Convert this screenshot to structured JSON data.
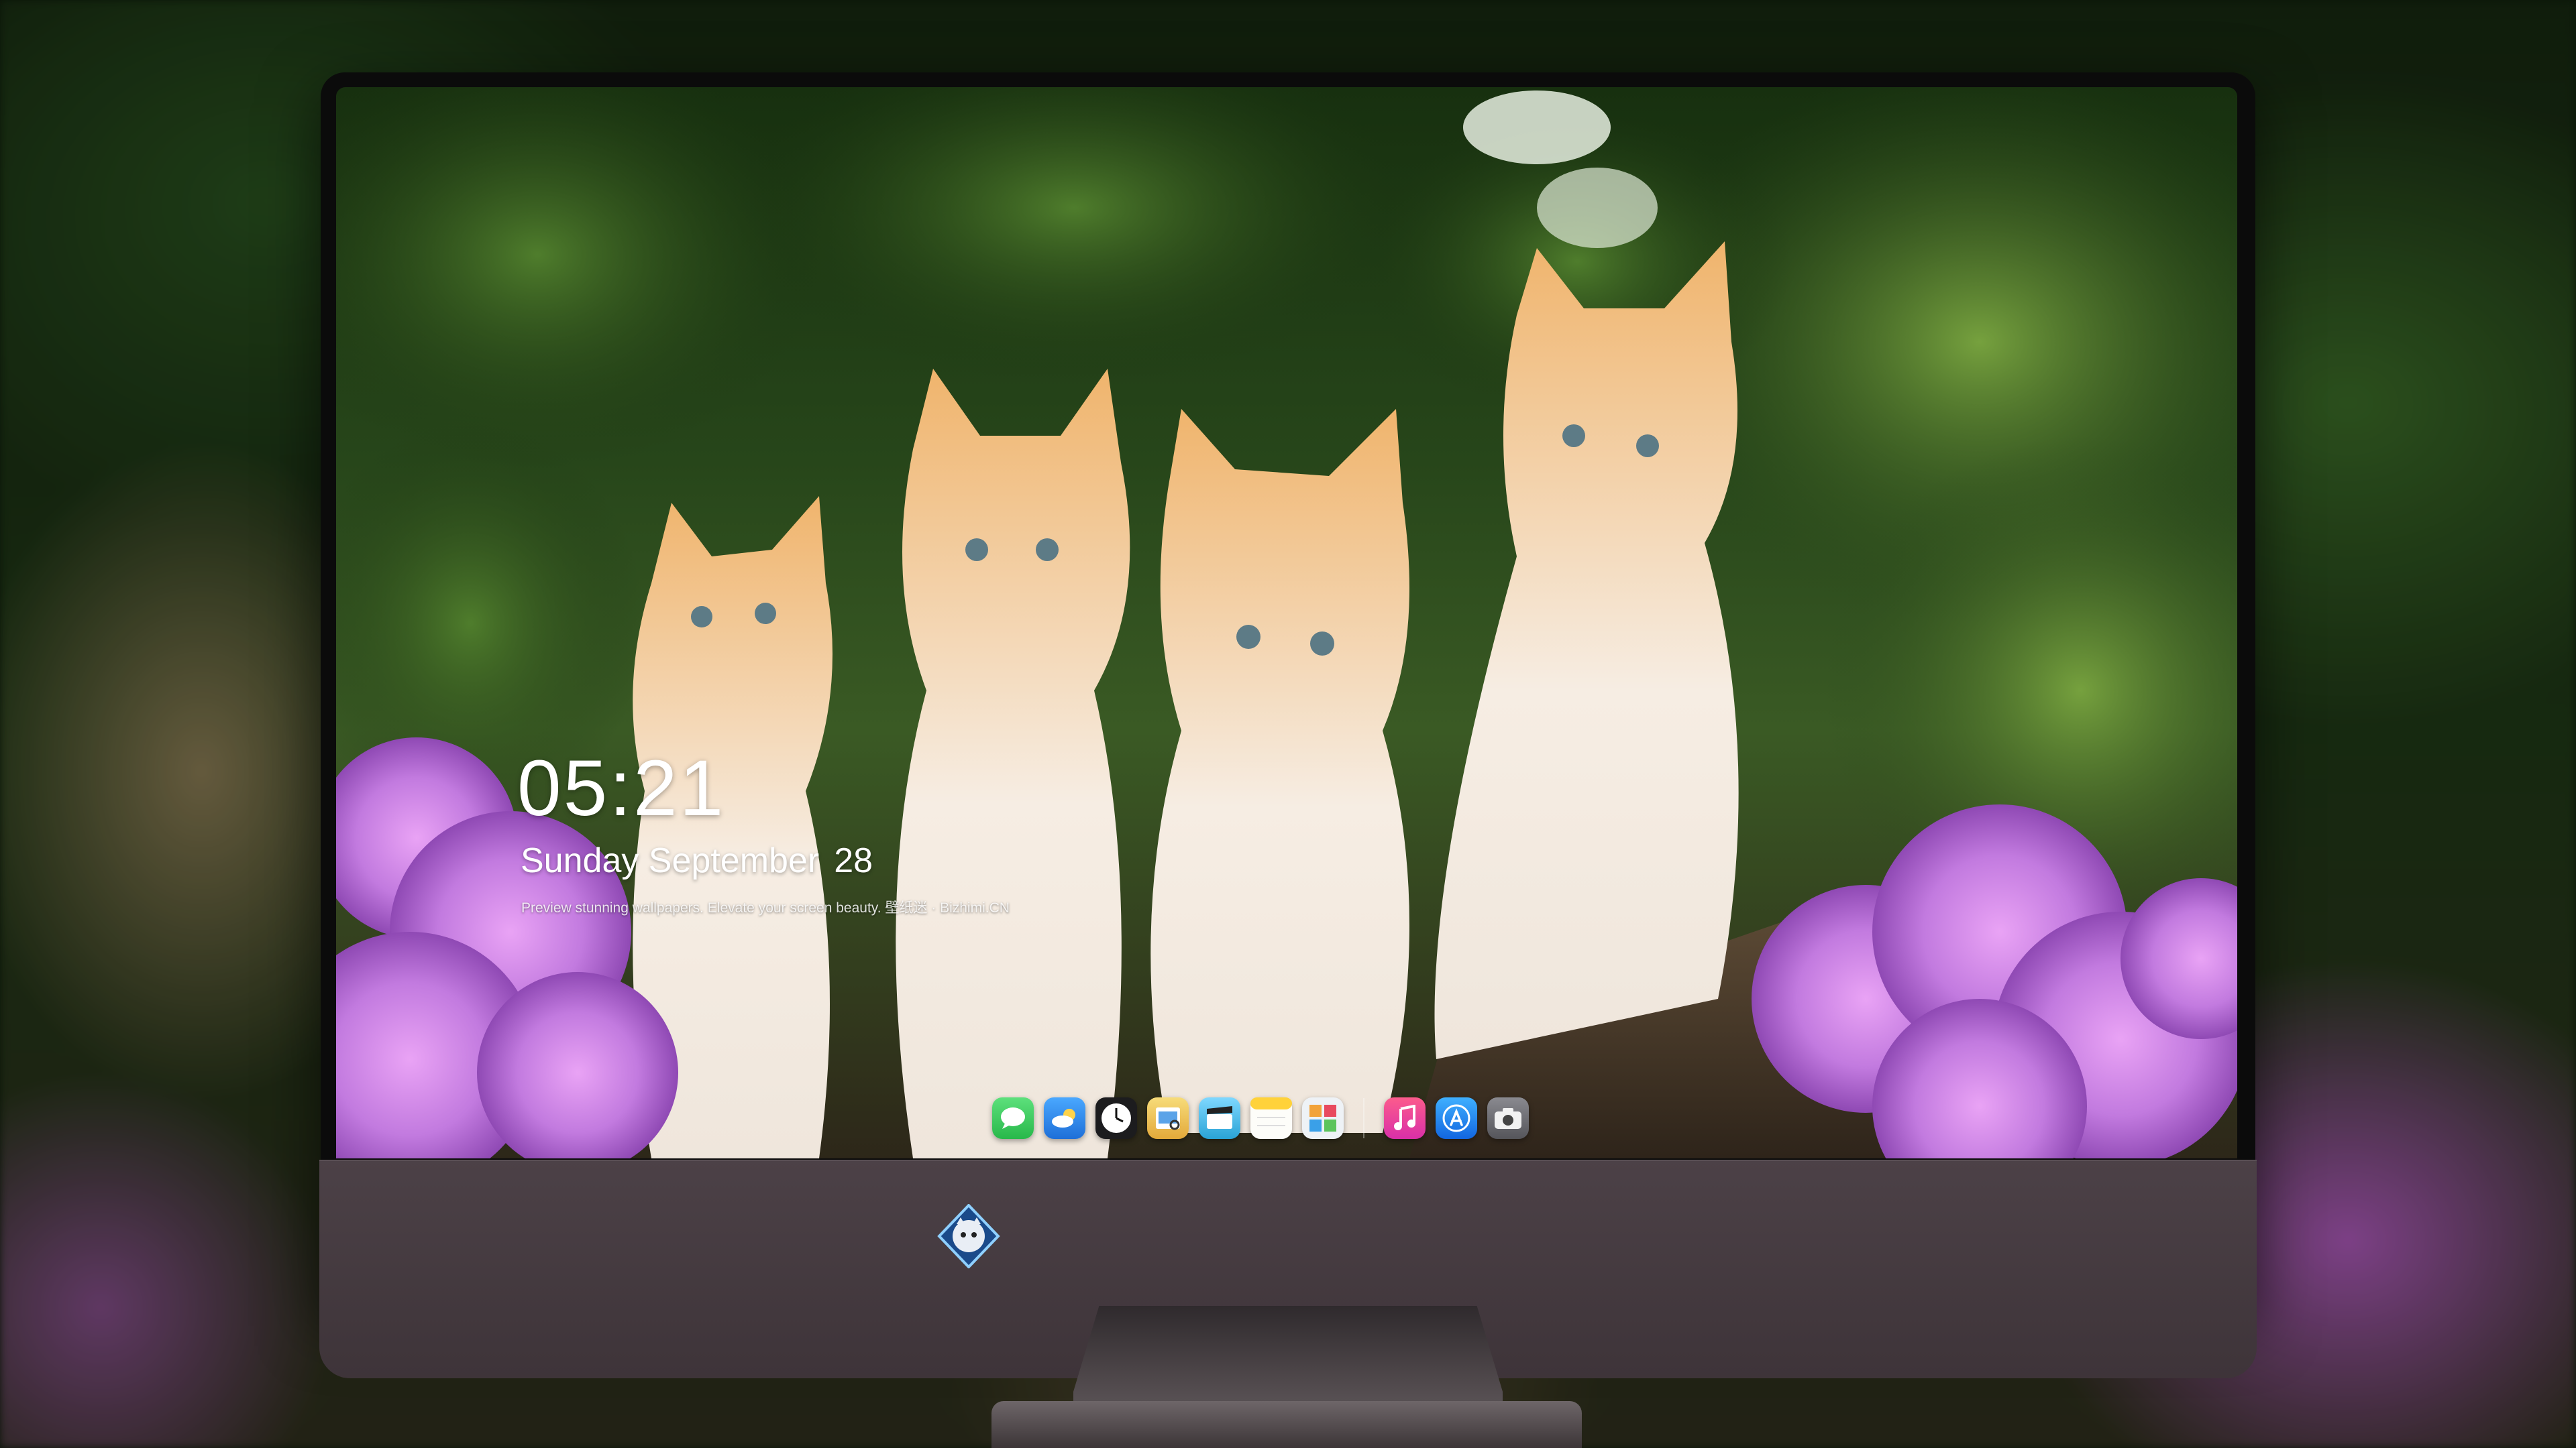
{
  "lockscreen": {
    "time": "05:21",
    "weekday_month": "Sunday September",
    "day": "28",
    "caption": "Preview stunning wallpapers. Elevate your screen beauty. 壁纸迷 · Bizhimi.CN"
  },
  "dock": {
    "apps": [
      {
        "name": "messages-icon",
        "color": "#34c759"
      },
      {
        "name": "weather-icon",
        "color": "#2f8cf0"
      },
      {
        "name": "clock-icon",
        "color": "#1c1c1e"
      },
      {
        "name": "preview-icon",
        "color": "#f2c94c"
      },
      {
        "name": "clips-icon",
        "color": "#3ab8e8"
      },
      {
        "name": "notes-icon",
        "color": "#ffd23a"
      },
      {
        "name": "photo-booth-icon",
        "color": "#e8eef5"
      },
      {
        "name": "music-icon",
        "color": "#fb3b6e"
      },
      {
        "name": "app-store-icon",
        "color": "#1a8cff"
      },
      {
        "name": "screenshot-icon",
        "color": "#6d6d72"
      }
    ]
  },
  "theme": {
    "chin_color": "#463b41",
    "flower_color": "#c27adf",
    "kitten_color": "#e8a45a"
  }
}
